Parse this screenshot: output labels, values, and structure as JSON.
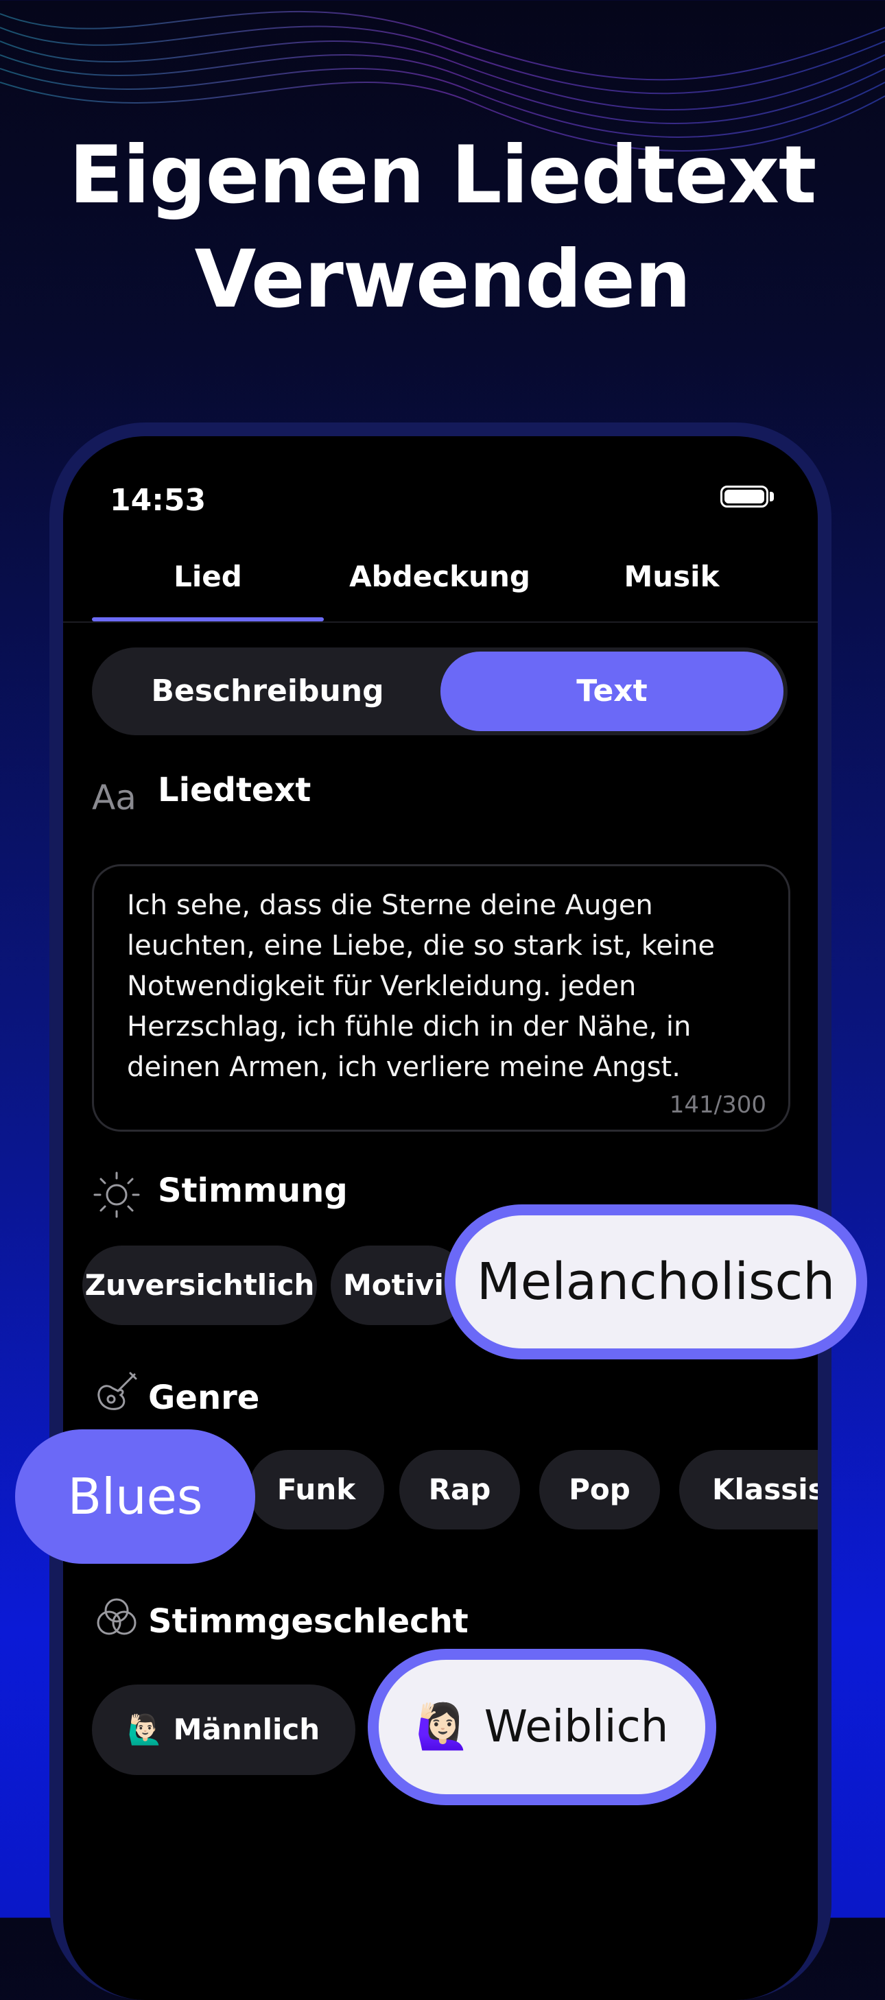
{
  "headline": {
    "line1": "Eigenen Liedtext",
    "line2": "Verwenden"
  },
  "status": {
    "time": "14:53"
  },
  "tabs": [
    {
      "label": "Lied"
    },
    {
      "label": "Abdeckung"
    },
    {
      "label": "Musik"
    }
  ],
  "segment": {
    "left": "Beschreibung",
    "right": "Text"
  },
  "lyrics": {
    "section_label": "Liedtext",
    "text": "Ich sehe, dass die Sterne deine Augen leuchten, eine Liebe, die so stark ist, keine Notwendigkeit für Verkleidung. jeden Herzschlag, ich fühle dich in der Nähe, in deinen Armen, ich verliere meine Angst.",
    "counter": "141/300"
  },
  "mood": {
    "section_label": "Stimmung",
    "chips": [
      "Zuversichtlich",
      "Motivie"
    ],
    "selected": "Melancholisch"
  },
  "genre": {
    "section_label": "Genre",
    "selected": "Blues",
    "chips": [
      "Funk",
      "Rap",
      "Pop",
      "Klassisc"
    ]
  },
  "voice": {
    "section_label": "Stimmgeschlecht",
    "male": "🙋🏻‍♂️ Männlich",
    "female": "🙋🏻‍♀️ Weiblich"
  },
  "colors": {
    "accent": "#6b69f7",
    "chip_bg": "#1e1e24",
    "highlight_bg": "#f1f0f7"
  }
}
